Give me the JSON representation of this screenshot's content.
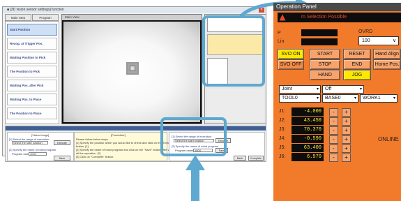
{
  "teach": {
    "title": "■ [3D vision sensor settings] function",
    "tabs": [
      "Main Step",
      "Program"
    ],
    "steps": [
      "Start Position",
      "Recog. at Trigger Pos.",
      "Waiting Position to Pick",
      "The Position to Pick",
      "Waiting Pos. after Pick",
      "Waiting Pos. to Place",
      "The Position to Place"
    ],
    "camera_header": "Main View",
    "lower_left": {
      "header": "[Vision Image]",
      "label1": "[1] Select the range of execution",
      "select1": "Select the start position",
      "execute": "Execute",
      "label2": "[2] Specify the name of robot program",
      "program_name_label": "Program name:",
      "program_name_value": "1004",
      "save": "Save"
    },
    "lower_mid": {
      "header": "[Procedure]",
      "lines": [
        "Please follow below steps.",
        "[1] Specify the position which you would like to check and click on the \"Execute\"",
        "button. [1]",
        "[2] Specify the name of robot program and click on the \"Save\" button after verifying",
        "all the operation. [2]",
        "[3] Click on \"Complete\" button."
      ]
    },
    "lower_right": {
      "label1": "[1] Select the range of execution",
      "select1": "Select the start position",
      "execute": "Execute",
      "label2": "[2] Specify the name of robot program",
      "program_name_label": "Program name:",
      "program_name_value": "1004",
      "save": "Save",
      "back": "Back",
      "complete": "Complete"
    }
  },
  "op": {
    "title": "Operation Panel",
    "status": "m Selection Possible",
    "ovrd_label": "OVRD",
    "ovrd_value": "100",
    "left_label_1": "P",
    "left_label_2": "Lin",
    "buttons": {
      "svo_on": "SVO ON",
      "start": "START",
      "reset": "RESET",
      "hand_align": "Hand Align",
      "svo_off": "SVO OFF",
      "stop": "STOP",
      "end": "END",
      "home_pos": "Home Pos.",
      "hand": "HAND",
      "jog": "JOG"
    },
    "selects": {
      "mode": "Joint",
      "step": "Off",
      "tool": "TOOL0",
      "base": "BASE0",
      "work": "WORK1"
    },
    "joints": [
      {
        "label": "J1:",
        "value": "-4.000"
      },
      {
        "label": "J2:",
        "value": "43.450"
      },
      {
        "label": "J3:",
        "value": "70.370"
      },
      {
        "label": "J4:",
        "value": "-0.590"
      },
      {
        "label": "J5:",
        "value": "63.400"
      },
      {
        "label": "J6:",
        "value": "6.970"
      }
    ],
    "minus": "-",
    "plus": "+",
    "online": "ONLINE"
  },
  "colors": {
    "panel_orange": "#f27a2b",
    "button_orange": "#f9a36c",
    "active_yellow": "#ffe800",
    "highlight_ring": "#5fa8cf",
    "status_text_red": "#e24a2a",
    "value_yellow": "#ffef2a"
  },
  "icons": [
    "close-icon",
    "warning-icon",
    "chevron-down-icon",
    "arrow-icon"
  ]
}
